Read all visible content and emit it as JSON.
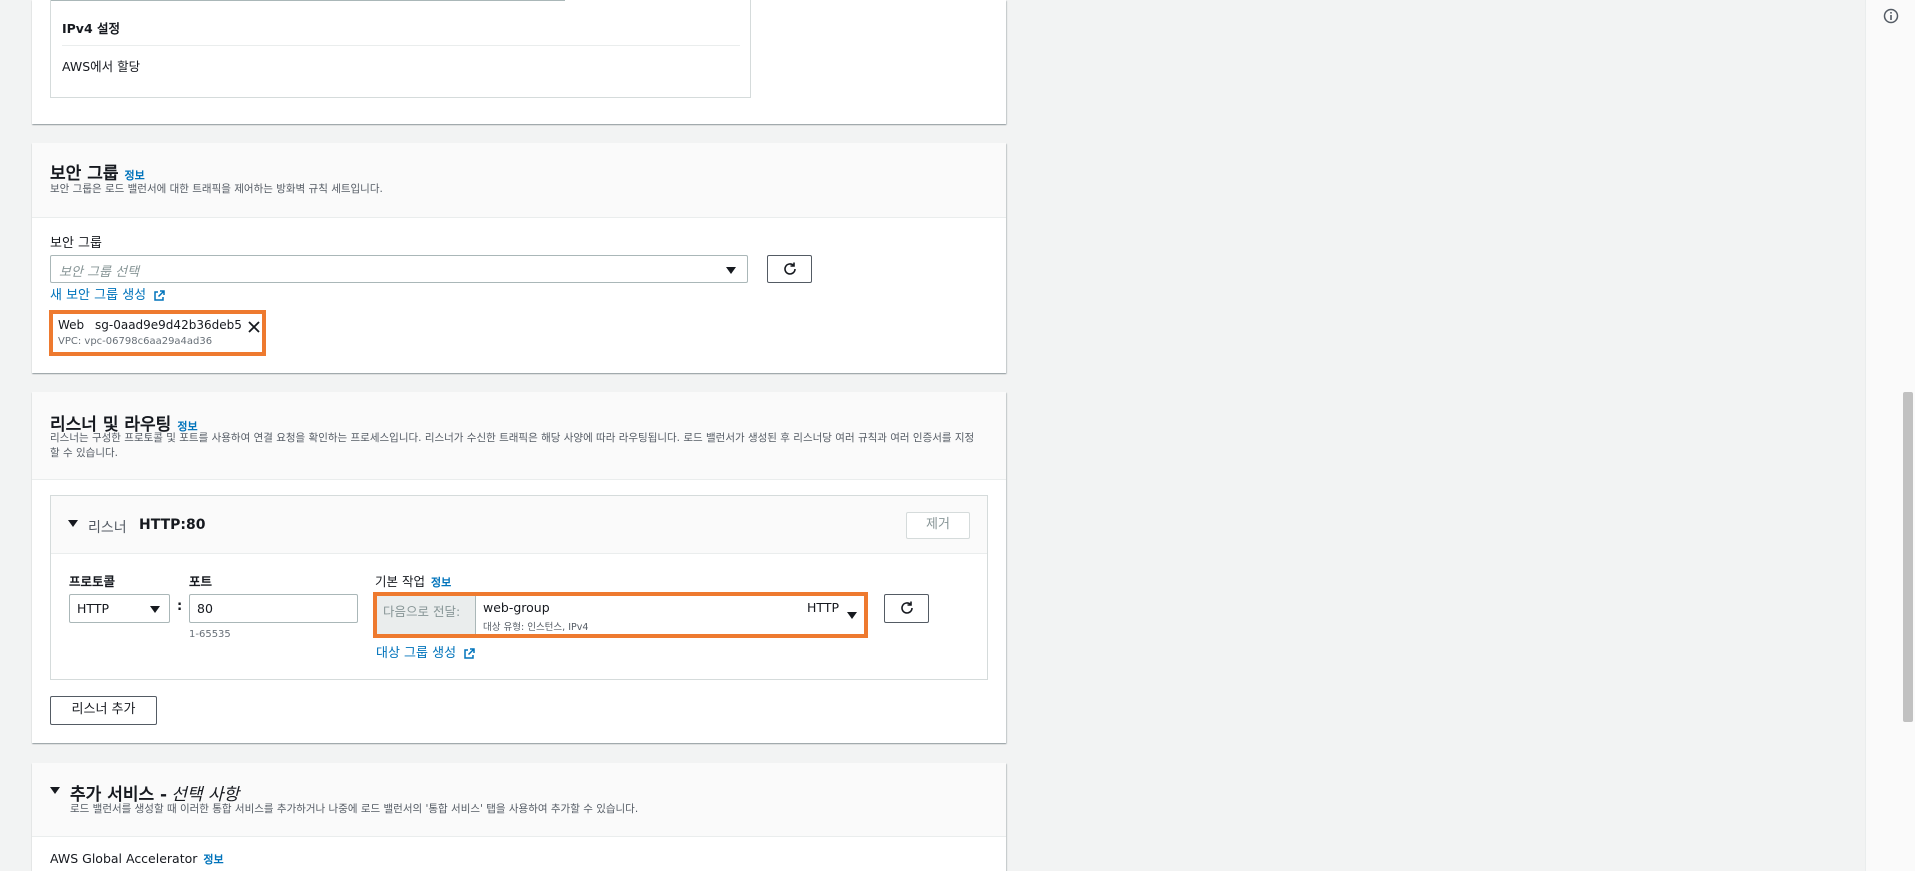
{
  "network": {
    "ipv4_heading": "IPv4 설정",
    "ipv4_value": "AWS에서 할당"
  },
  "security_group": {
    "title": "보안 그룹",
    "info": "정보",
    "description": "보안 그룹은 로드 밸런서에 대한 트래픽을 제어하는 방화벽 규칙 세트입니다.",
    "field_label": "보안 그룹",
    "placeholder": "보안 그룹 선택",
    "create_link": "새 보안 그룹 생성",
    "selected": {
      "name": "Web",
      "id": "sg-0aad9e9d42b36deb5",
      "vpc": "VPC: vpc-06798c6aa29a4ad36"
    }
  },
  "listeners": {
    "title": "리스너 및 라우팅",
    "info": "정보",
    "description": "리스너는 구성한 프로토콜 및 포트를 사용하여 연결 요청을 확인하는 프로세스입니다. 리스너가 수신한 트래픽은 해당 사양에 따라 라우팅됩니다. 로드 밸런서가 생성된 후 리스너당 여러 규칙과 여러 인증서를 지정할 수 있습니다.",
    "listener": {
      "prefix": "리스너",
      "name": "HTTP:80",
      "remove_label": "제거",
      "protocol_label": "프로토콜",
      "protocol_value": "HTTP",
      "port_label": "포트",
      "port_value": "80",
      "port_hint": "1-65535",
      "default_action_label": "기본 작업",
      "default_action_info": "정보",
      "forward_label": "다음으로 전달:",
      "target_group": "web-group",
      "target_protocol": "HTTP",
      "target_type": "대상 유형: 인스턴스, IPv4",
      "create_target_link": "대상 그룹 생성"
    },
    "add_listener_label": "리스너 추가"
  },
  "addons": {
    "title": "추가 서비스 -",
    "title_optional": "선택 사항",
    "description": "로드 밸런서를 생성할 때 이러한 통합 서비스를 추가하거나 나중에 로드 밸런서의 '통합 서비스' 탭을 사용하여 추가할 수 있습니다.",
    "global_accelerator_label": "AWS Global Accelerator",
    "info": "정보"
  },
  "icons": [
    "info-circle-icon",
    "refresh-icon",
    "external-link-icon",
    "close-icon",
    "caret-down-icon"
  ],
  "colors": {
    "accent": "#0073bb",
    "highlight": "#ee7a2f",
    "background": "#f2f3f3"
  }
}
